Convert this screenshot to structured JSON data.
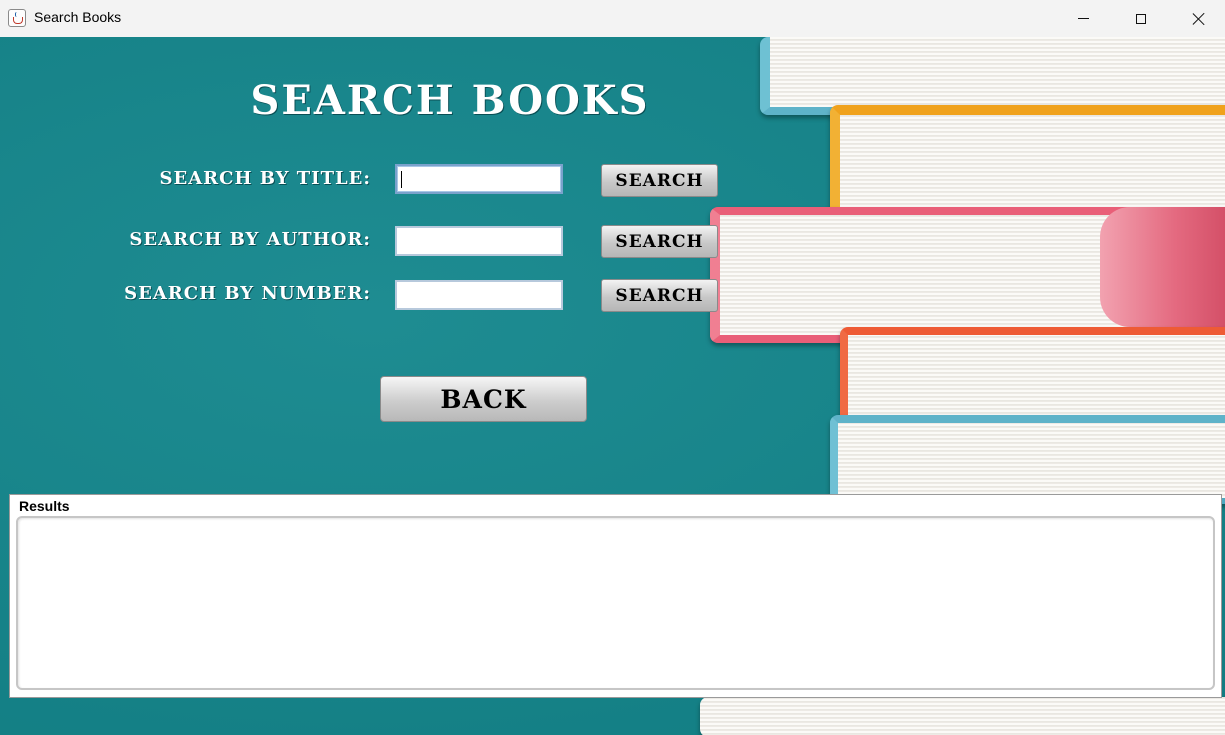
{
  "window": {
    "title": "Search Books",
    "icon": "java-cup-icon"
  },
  "heading": "SEARCH BOOKS",
  "search_rows": [
    {
      "label": "SEARCH BY TITLE:",
      "value": "",
      "button": "SEARCH",
      "focused": true
    },
    {
      "label": "SEARCH BY AUTHOR:",
      "value": "",
      "button": "SEARCH",
      "focused": false
    },
    {
      "label": "SEARCH BY NUMBER:",
      "value": "",
      "button": "SEARCH",
      "focused": false
    }
  ],
  "back_button": "BACK",
  "results": {
    "title": "Results",
    "content": ""
  },
  "colors": {
    "background": "#12868c",
    "text": "#ffffff"
  }
}
